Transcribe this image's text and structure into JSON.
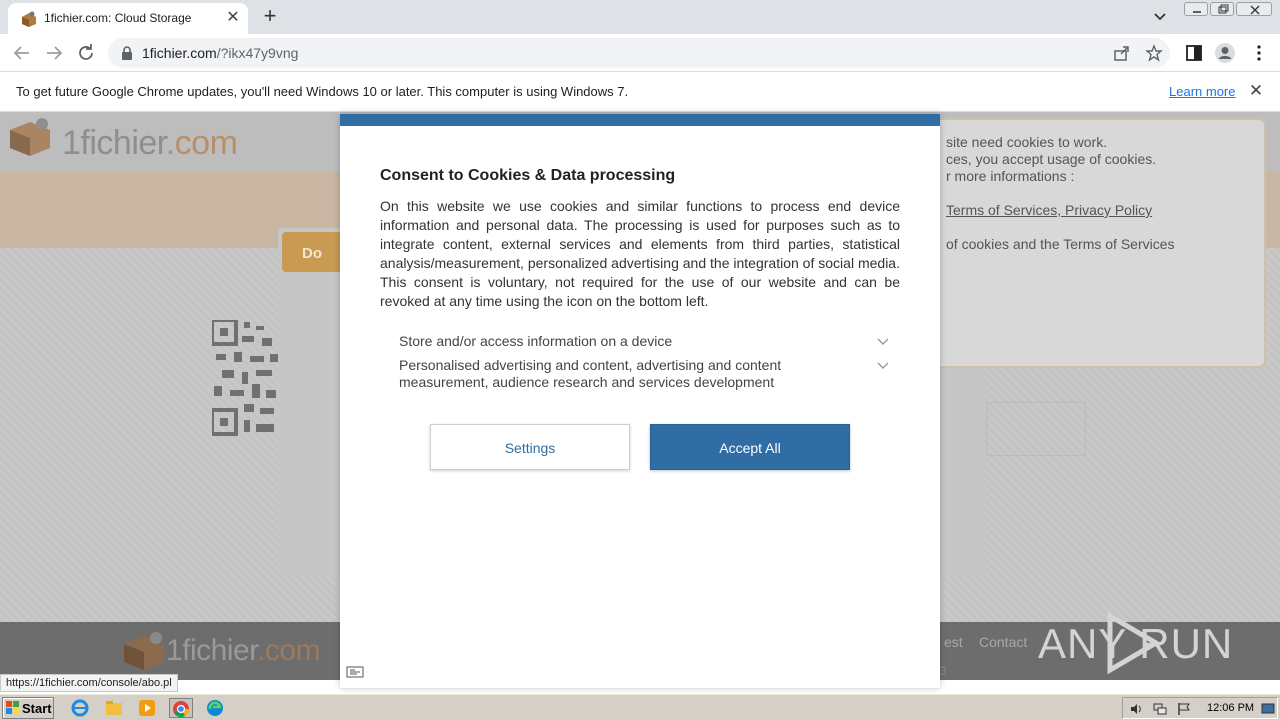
{
  "browser": {
    "tab_title": "1fichier.com: Cloud Storage",
    "url_host": "1fichier.com",
    "url_path": "/?ikx47y9vng",
    "infobar_text": "To get future Google Chrome updates, you'll need Windows 10 or later. This computer is using Windows 7.",
    "infobar_link": "Learn more",
    "status_url": "https://1fichier.com/console/abo.pl"
  },
  "site": {
    "logo_part1": "1fichier",
    "logo_part2": ".com",
    "download_label": "Do",
    "right_card_lines": [
      "site need cookies to work.",
      "ces, you accept usage of cookies.",
      "r more informations :"
    ],
    "right_card_link1": "Terms of Services, Privacy Policy",
    "right_card_link2": "of cookies and the Terms of Services",
    "footer_link1": "est",
    "footer_link2": "Contact",
    "footer_fragment": "3",
    "watermark": "ANY RUN"
  },
  "consent": {
    "title": "Consent to Cookies & Data processing",
    "body": "On this website we use cookies and similar functions to process end device information and personal data. The processing is used for purposes such as to integrate content, external services and elements from third parties, statistical analysis/measurement, personalized advertising and the integration of social media. This consent is voluntary, not required for the use of our website and can be revoked at any time using the icon on the bottom left.",
    "purposes": [
      "Store and/or access information on a device",
      "Personalised advertising and content, advertising and content measurement, audience research and services development"
    ],
    "settings_label": "Settings",
    "accept_label": "Accept All"
  },
  "taskbar": {
    "start_label": "Start",
    "clock": "12:06 PM"
  },
  "colors": {
    "accent_blue": "#2f6da4",
    "chrome_tabstrip": "#dee1e6",
    "link_blue": "#1a73e8"
  }
}
